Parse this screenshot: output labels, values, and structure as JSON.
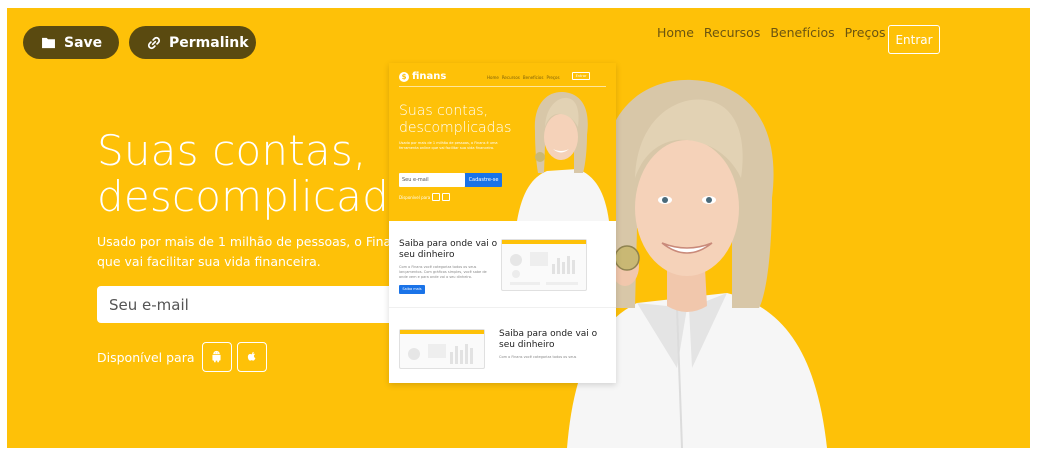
{
  "overlay": {
    "save_label": "Save",
    "permalink_label": "Permalink"
  },
  "nav": {
    "links": [
      "Home",
      "Recursos",
      "Benefícios",
      "Preços"
    ],
    "enter_label": "Entrar"
  },
  "hero": {
    "headline_line1": "Suas contas,",
    "headline_line2": "descomplicadas",
    "subtext_line1": "Usado por mais de 1 milhão de pessoas, o Finans é um",
    "subtext_line2": "que vai facilitar sua vida financeira.",
    "email_placeholder": "Seu e-mail",
    "available_label": "Disponível para"
  },
  "preview": {
    "brand": "finans",
    "nav_links": [
      "Home",
      "Recursos",
      "Benefícios",
      "Preços"
    ],
    "enter_label": "Entrar",
    "headline_line1": "Suas contas,",
    "headline_line2": "descomplicadas",
    "subtext": "Usado por mais de 1 milhão de pessoas, o Finans é uma ferramenta online que vai facilitar sua vida financeira.",
    "email_placeholder": "Seu e-mail",
    "cta_label": "Cadastre-se",
    "available_label": "Disponível para",
    "section1_title_line1": "Saiba para onde vai o",
    "section1_title_line2": "seu dinheiro",
    "section1_text": "Com o Finans você categoriza todos os seus lançamentos. Com gráficos simples, você sabe de onde vem e para onde vai o seu dinheiro.",
    "section1_button": "Saiba mais",
    "section2_title_line1": "Saiba para onde vai o",
    "section2_title_line2": "seu dinheiro",
    "section2_text": "Com o Finans você categoriza todos os seus"
  },
  "colors": {
    "brand_yellow": "#fec108",
    "overlay_button": "#5a4a10",
    "cta_blue": "#1a73e8"
  }
}
